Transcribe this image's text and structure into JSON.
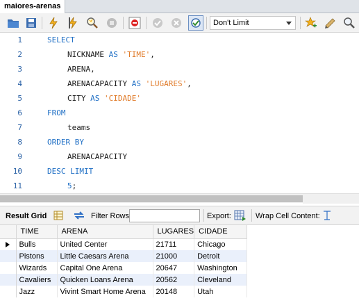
{
  "tab": {
    "title": "maiores-arenas"
  },
  "toolbar": {
    "limit_value": "Don't Limit",
    "icons": [
      "open-folder-icon",
      "save-icon",
      "execute-lightning-icon",
      "execute-cursor-lightning-icon",
      "explain-magnifier-icon",
      "stop-hand-icon",
      "toggle-error-stop-icon",
      "commit-check-icon",
      "rollback-cancel-icon",
      "autocommit-icon",
      "limit-select",
      "add-snippet-star-icon",
      "beautify-brush-icon",
      "find-magnifier-icon"
    ]
  },
  "editor": {
    "lines": [
      {
        "n": "1",
        "tokens": [
          {
            "t": "SELECT",
            "c": "kw"
          }
        ],
        "indent": 0
      },
      {
        "n": "2",
        "tokens": [
          {
            "t": "NICKNAME ",
            "c": ""
          },
          {
            "t": "AS",
            "c": "kw"
          },
          {
            "t": " ",
            "c": ""
          },
          {
            "t": "'TIME'",
            "c": "str"
          },
          {
            "t": ",",
            "c": ""
          }
        ],
        "indent": 1
      },
      {
        "n": "3",
        "tokens": [
          {
            "t": "ARENA,",
            "c": ""
          }
        ],
        "indent": 1
      },
      {
        "n": "4",
        "tokens": [
          {
            "t": "ARENACAPACITY ",
            "c": ""
          },
          {
            "t": "AS",
            "c": "kw"
          },
          {
            "t": " ",
            "c": ""
          },
          {
            "t": "'LUGARES'",
            "c": "str"
          },
          {
            "t": ",",
            "c": ""
          }
        ],
        "indent": 1
      },
      {
        "n": "5",
        "tokens": [
          {
            "t": "CITY ",
            "c": ""
          },
          {
            "t": "AS",
            "c": "kw"
          },
          {
            "t": " ",
            "c": ""
          },
          {
            "t": "'CIDADE'",
            "c": "str"
          }
        ],
        "indent": 1
      },
      {
        "n": "6",
        "tokens": [
          {
            "t": "FROM",
            "c": "kw"
          }
        ],
        "indent": 0
      },
      {
        "n": "7",
        "tokens": [
          {
            "t": "teams",
            "c": ""
          }
        ],
        "indent": 1
      },
      {
        "n": "8",
        "tokens": [
          {
            "t": "ORDER BY",
            "c": "kw"
          }
        ],
        "indent": 0
      },
      {
        "n": "9",
        "tokens": [
          {
            "t": "ARENACAPACITY",
            "c": ""
          }
        ],
        "indent": 1
      },
      {
        "n": "10",
        "tokens": [
          {
            "t": "DESC LIMIT",
            "c": "kw"
          }
        ],
        "indent": 0
      },
      {
        "n": "11",
        "tokens": [
          {
            "t": "5",
            "c": "num"
          },
          {
            "t": ";",
            "c": ""
          }
        ],
        "indent": 1
      }
    ]
  },
  "result_bar": {
    "result_grid": "Result Grid",
    "filter_rows": "Filter Rows:",
    "export": "Export:",
    "wrap": "Wrap Cell Content:"
  },
  "grid": {
    "headers": [
      "TIME",
      "ARENA",
      "LUGARES",
      "CIDADE"
    ],
    "rows": [
      [
        "Bulls",
        "United Center",
        "21711",
        "Chicago"
      ],
      [
        "Pistons",
        "Little Caesars Arena",
        "21000",
        "Detroit"
      ],
      [
        "Wizards",
        "Capital One Arena",
        "20647",
        "Washington"
      ],
      [
        "Cavaliers",
        "Quicken Loans Arena",
        "20562",
        "Cleveland"
      ],
      [
        "Jazz",
        "Vivint Smart Home Arena",
        "20148",
        "Utah"
      ]
    ]
  }
}
